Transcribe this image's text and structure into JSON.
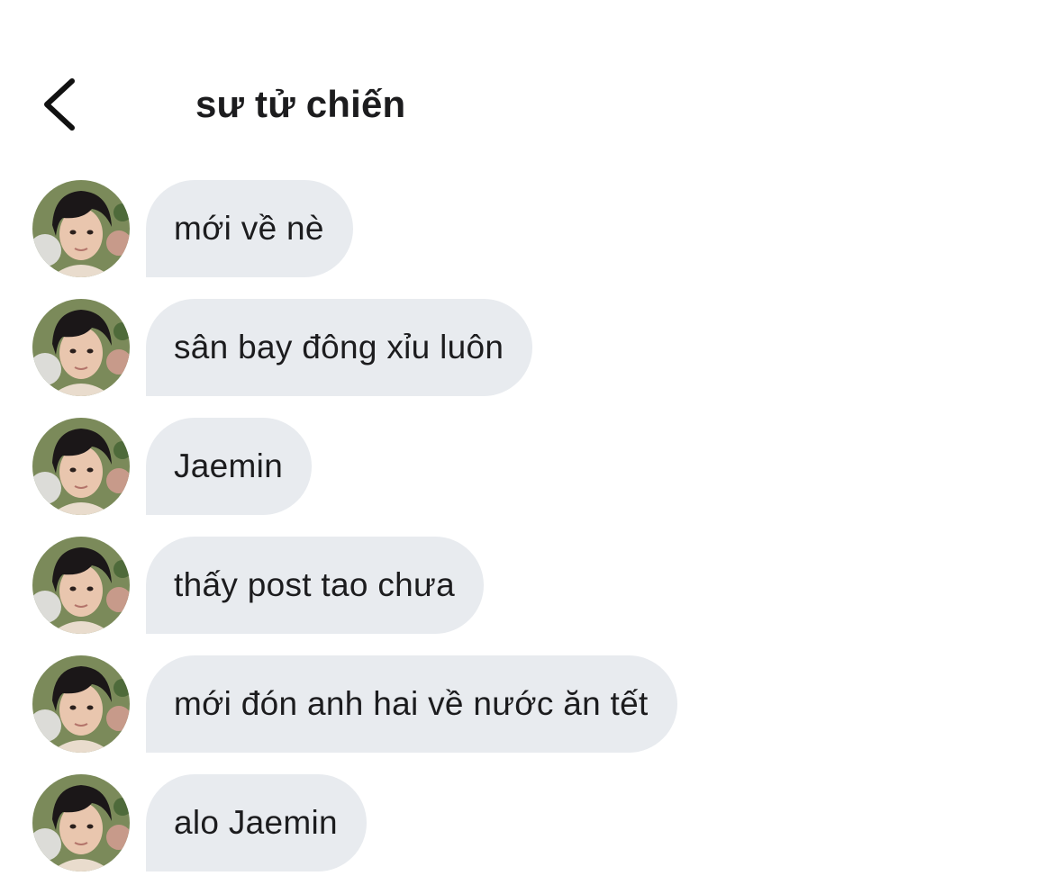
{
  "header": {
    "title": "sư tử chiến",
    "back_icon": "chevron-left-icon"
  },
  "messages": [
    {
      "text": "mới về nè"
    },
    {
      "text": "sân bay đông xỉu luôn"
    },
    {
      "text": "Jaemin"
    },
    {
      "text": "thấy post tao chưa"
    },
    {
      "text": "mới đón anh hai về nước ăn tết"
    },
    {
      "text": "alo Jaemin"
    }
  ],
  "colors": {
    "bubble_background": "#e8ebef",
    "text": "#1c1c1e",
    "background": "#ffffff"
  }
}
